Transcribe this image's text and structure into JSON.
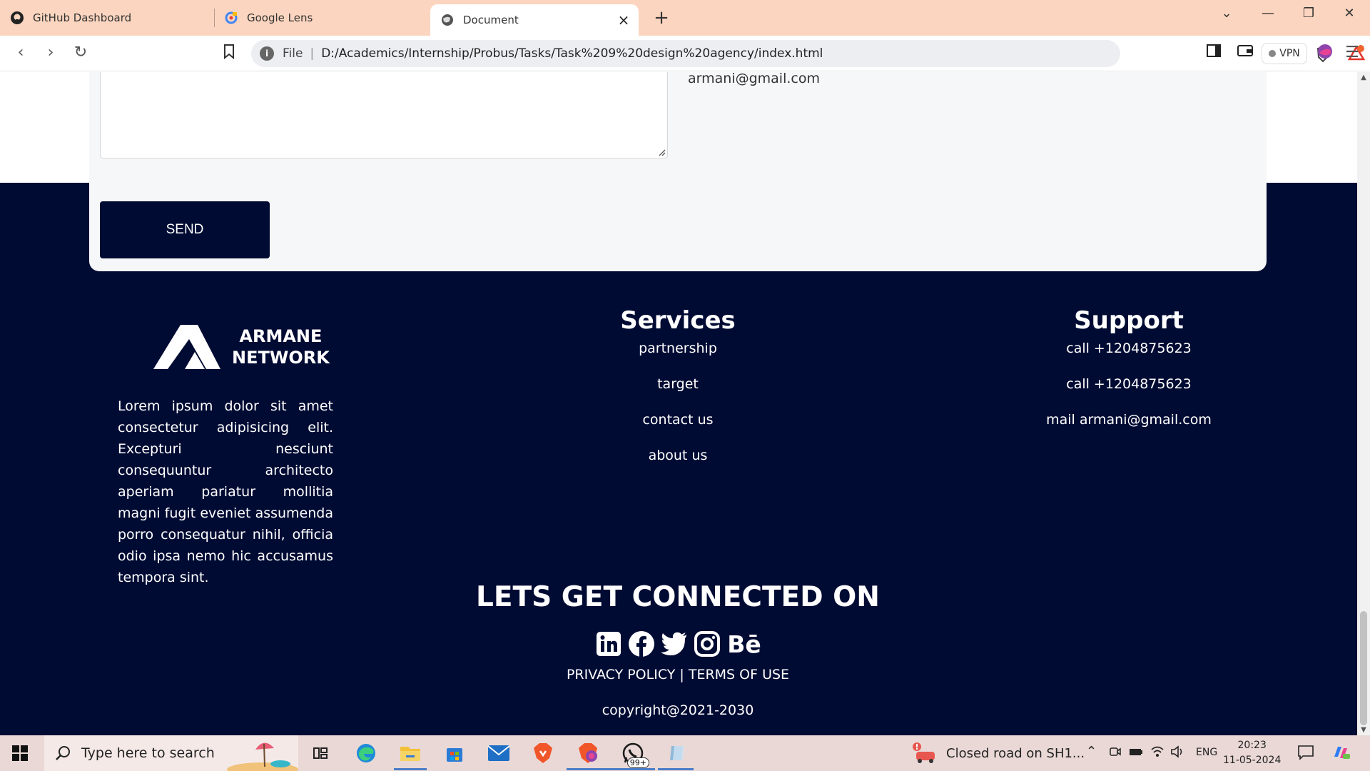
{
  "browser": {
    "tabs": [
      {
        "label": "GitHub Dashboard",
        "icon": "github-icon"
      },
      {
        "label": "Google Lens",
        "icon": "google-lens-icon"
      },
      {
        "label": "Document",
        "icon": "globe-icon",
        "active": true
      }
    ],
    "url_scheme_label": "File",
    "url": "D:/Academics/Internship/Probus/Tasks/Task%209%20design%20agency/index.html",
    "rewards_badge": "1",
    "vpn_label": "VPN"
  },
  "contact_section": {
    "email": "armani@gmail.com",
    "send_label": "SEND"
  },
  "footer": {
    "brand": {
      "line1": "ARMANE",
      "line2": "NETWORK"
    },
    "description": "Lorem ipsum dolor sit amet consectetur adipisicing elit. Excepturi nesciunt consequuntur architecto aperiam pariatur mollitia magni fugit eveniet assumenda porro consequatur nihil, officia odio ipsa nemo hic accusamus tempora sint.",
    "services": {
      "title": "Services",
      "items": [
        "partnership",
        "target",
        "contact us",
        "about us"
      ]
    },
    "support": {
      "title": "Support",
      "items": [
        "call +1204875623",
        "call +1204875623",
        "mail armani@gmail.com"
      ]
    },
    "connect_title": "LETS GET CONNECTED ON",
    "social": [
      "linkedin-icon",
      "facebook-icon",
      "twitter-icon",
      "instagram-icon",
      "behance-icon"
    ],
    "behance_glyph": "Bē",
    "legal": "PRIVACY POLICY | TERMS OF USE",
    "copyright": "copyright@2021-2030"
  },
  "taskbar": {
    "search_placeholder": "Type here to search",
    "whatsapp_badge": "99+",
    "news_text": "Closed road on SH1...",
    "language": "ENG",
    "time": "20:23",
    "date": "11-05-2024"
  },
  "colors": {
    "navy": "#000b33",
    "tabbar": "#fbd5bf",
    "taskbar": "#e9d8d6"
  }
}
